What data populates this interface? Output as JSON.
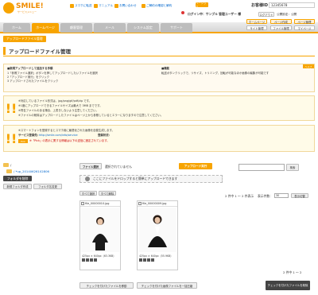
{
  "header": {
    "logo_text": "SMILE!",
    "logo_sub": "サービスメニュー",
    "links": [
      "スマホに転送",
      "マニュアル",
      "お問い合わせ",
      "ご解約の確認と解約"
    ],
    "status_label": "ベーシック",
    "login_info": "ログイン中：サンプル 管理ユーザー 様",
    "logout": "ログアウト",
    "public_setting": "公開設定：公開",
    "customer": "お客様ID",
    "customer_id": "12345678"
  },
  "nav": {
    "tabs": [
      "ホーム",
      "ホームページ",
      "顧客管理",
      "メール",
      "システム設定",
      "サポート"
    ],
    "right_buttons": [
      "ホームページ",
      "ページ作成",
      "ページ管理",
      "サイト管理",
      "ファイル管理",
      "マイページ"
    ]
  },
  "breadcrumb": "アップロードファイル管理",
  "page_title": "アップロードファイル管理",
  "help": {
    "tag": "ヘルプ",
    "col1_title": "■新規アップロードして追加する手順",
    "col1_lines": [
      "1「参照ファイル選択」ボタンを押してアップロードしたいファイルを選択",
      "2「アップロード実行」をクリック",
      "3 アップロードされたファイルをクリック"
    ],
    "col2_title": "■機能",
    "col2_lines": [
      "転送ボタンクリックで、リサイズ、トリミング、回転が可能なほか画像の編集が可能です"
    ]
  },
  "warning1": {
    "lines": [
      "※対応しているファイル形式は、jpg/png/gif/pdf/zip です。",
      "※1度にアップロードできるファイルサイズは最大で 3MB までです。",
      "※同名ファイルのある場合、上書きしないよう注意してください。",
      "※ファイルの削除はアップロードしたファイルはページ上から参照しているとエラーになりますので注意してください。"
    ]
  },
  "warning2": {
    "line1": "※スマートフォンを登録するとスマホ用に最適化された画像を自動生成します。",
    "service_label": "サービス登録先：",
    "service_url": "http://smile.com/info/service",
    "registered_label": "登録状況：",
    "note": "※「Pick」の表示に関する情報は以下の送信に固定されています。"
  },
  "left": {
    "root_label": "/",
    "subfolder": "/ *up_20140626102806",
    "new_folder_btn": "フォルダを削除",
    "btn_a": "新規フォルダ作成",
    "btn_b": "フォルダ名変更"
  },
  "upload": {
    "choose_btn": "ファイル選択",
    "not_selected": "選択されていません",
    "execute_btn": "アップロード実行",
    "drop_hint": "ここにファイルをドロップすると簡単にアップロードできます",
    "search_btn": "検索"
  },
  "list": {
    "select_all": "すべて選択",
    "deselect_all": "すべて解除",
    "count_text": "2 件中 1 ～ 2 件表示",
    "per_page_label": "表示件数：",
    "per_page": "30",
    "per_page_btn": "表示切替",
    "footer_count": "2 件中 1 ～ 2"
  },
  "files": [
    {
      "name": "file_00000010.jpg",
      "meta": "425px × 640px（63.3KB）"
    },
    {
      "name": "file_00000009.jpg",
      "meta": "425px × 640px（55.9KB）"
    }
  ],
  "bottom": {
    "move_btn": "チェックを付けたファイルを移動",
    "thumb_btn": "チェックを付けた画像ファイルを一括圧縮",
    "delete_btn": "チェックを付けたファイルを削除"
  },
  "colors": {
    "accent": "#f7a400",
    "nav_gray": "#bdbdbd"
  }
}
